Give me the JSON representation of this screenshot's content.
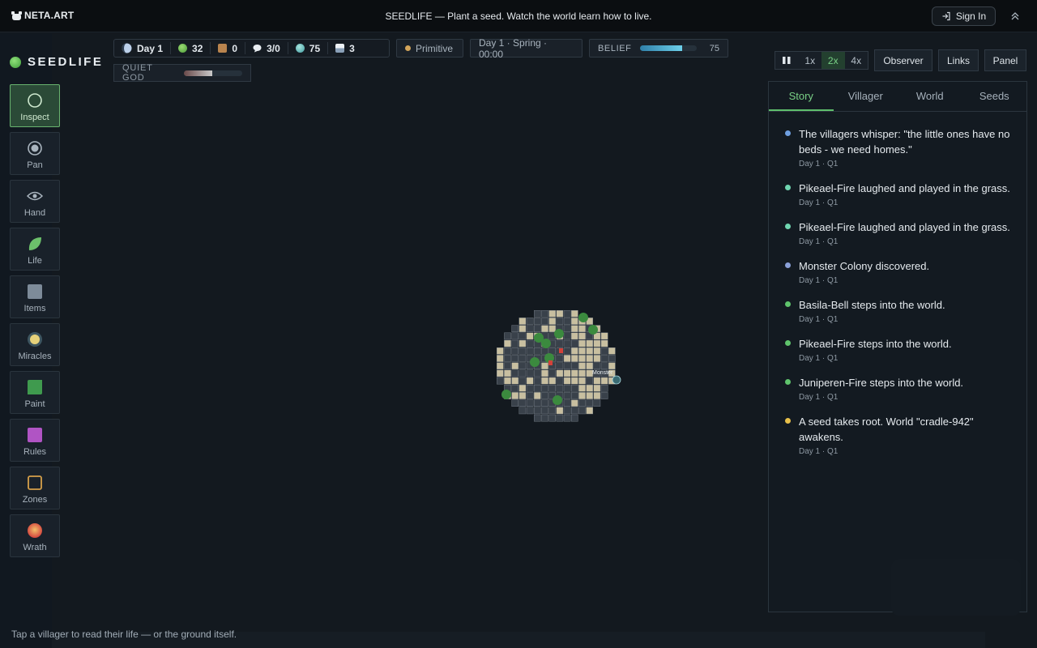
{
  "brand": "NETA.ART",
  "tagline": "SEEDLIFE — Plant a seed. Watch the world learn how to live.",
  "sign_in": "Sign In",
  "app_title": "SEEDLIFE",
  "tools": [
    {
      "label": "Inspect",
      "icon": "circle-outline-icon"
    },
    {
      "label": "Pan",
      "icon": "target-icon"
    },
    {
      "label": "Hand",
      "icon": "eye-icon"
    },
    {
      "label": "Life",
      "icon": "leaf-icon"
    },
    {
      "label": "Items",
      "icon": "square-icon"
    },
    {
      "label": "Miracles",
      "icon": "sun-icon"
    },
    {
      "label": "Paint",
      "icon": "paint-icon"
    },
    {
      "label": "Rules",
      "icon": "rules-icon"
    },
    {
      "label": "Zones",
      "icon": "zone-square-icon"
    },
    {
      "label": "Wrath",
      "icon": "fireball-icon"
    }
  ],
  "stats": {
    "day": "Day 1",
    "life": "32",
    "items": "0",
    "villagers": "3/0",
    "mana": "75",
    "seeds": "3"
  },
  "era": "Primitive",
  "date": "Day 1 · Spring · 00:00",
  "belief": {
    "label": "BELIEF",
    "value": "75",
    "level": 0.75
  },
  "quiet_god": {
    "label": "QUIET GOD",
    "level": 0.48
  },
  "speed": {
    "pause": "pause-icon",
    "options": [
      "1x",
      "2x",
      "4x"
    ],
    "selected": "2x"
  },
  "view_buttons": [
    "Observer",
    "Links",
    "Panel"
  ],
  "tabs": [
    "Story",
    "Villager",
    "World",
    "Seeds"
  ],
  "active_tab": "Story",
  "colors": {
    "accent": "#79d086",
    "tile_light": "#c8bfa0",
    "tile_dark": "#39414a"
  },
  "map_label": "Monster",
  "story": [
    {
      "text": "The villagers whisper: \"the little ones have no beds - we need homes.\"",
      "time": "Day 1 · Q1",
      "color": "#6f9fe0"
    },
    {
      "text": "Pikeael-Fire laughed and played in the grass.",
      "time": "Day 1 · Q1",
      "color": "#6fd6b0"
    },
    {
      "text": "Pikeael-Fire laughed and played in the grass.",
      "time": "Day 1 · Q1",
      "color": "#6fd6b0"
    },
    {
      "text": "Monster Colony discovered.",
      "time": "Day 1 · Q1",
      "color": "#8aa0d8"
    },
    {
      "text": "Basila-Bell steps into the world.",
      "time": "Day 1 · Q1",
      "color": "#5fc46c"
    },
    {
      "text": "Pikeael-Fire steps into the world.",
      "time": "Day 1 · Q1",
      "color": "#5fc46c"
    },
    {
      "text": "Juniperen-Fire steps into the world.",
      "time": "Day 1 · Q1",
      "color": "#5fc46c"
    },
    {
      "text": "A seed takes root. World \"cradle-942\" awakens.",
      "time": "Day 1 · Q1",
      "color": "#e8c04a"
    }
  ],
  "hint": "Tap a villager to read their life — or the ground itself."
}
